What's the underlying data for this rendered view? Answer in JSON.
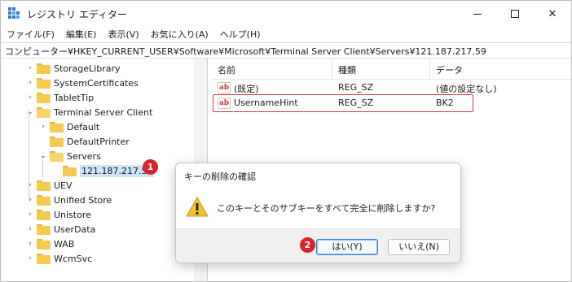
{
  "window": {
    "title": "レジストリ エディター"
  },
  "menu": [
    "ファイル(F)",
    "編集(E)",
    "表示(V)",
    "お気に入り(A)",
    "ヘルプ(H)"
  ],
  "address": "コンピューター¥HKEY_CURRENT_USER¥Software¥Microsoft¥Terminal Server Client¥Servers¥121.187.217.59",
  "tree": {
    "items": [
      {
        "label": "StorageLibrary",
        "expand": "collapsed"
      },
      {
        "label": "SystemCertificates",
        "expand": "collapsed"
      },
      {
        "label": "TabletTip",
        "expand": "collapsed"
      },
      {
        "label": "Terminal Server Client",
        "expand": "expanded"
      },
      {
        "label": "Default",
        "expand": "collapsed"
      },
      {
        "label": "DefaultPrinter",
        "expand": "none"
      },
      {
        "label": "Servers",
        "expand": "expanded"
      },
      {
        "label": "121.187.217.59",
        "expand": "none",
        "selected": true
      },
      {
        "label": "UEV",
        "expand": "collapsed"
      },
      {
        "label": "Unified Store",
        "expand": "collapsed"
      },
      {
        "label": "Unistore",
        "expand": "collapsed"
      },
      {
        "label": "UserData",
        "expand": "collapsed"
      },
      {
        "label": "WAB",
        "expand": "collapsed"
      },
      {
        "label": "WcmSvc",
        "expand": "collapsed"
      }
    ]
  },
  "list": {
    "columns": [
      "名前",
      "種類",
      "データ"
    ],
    "rows": [
      {
        "name": "(既定)",
        "type": "REG_SZ",
        "data": "(値の設定なし)"
      },
      {
        "name": "UsernameHint",
        "type": "REG_SZ",
        "data": "BK2"
      }
    ]
  },
  "dialog": {
    "title": "キーの削除の確認",
    "message": "このキーとそのサブキーをすべて完全に削除しますか?",
    "yes_label": "はい(Y)",
    "no_label": "いいえ(N)"
  },
  "badges": {
    "step1": "1",
    "step2": "2"
  },
  "colors": {
    "badge": "#d9222a",
    "highlight_border": "#d9363e",
    "selection": "#cce4f7",
    "folder": "#f6c94f"
  },
  "icons": {
    "app": "registry-editor-icon",
    "folder": "folder-icon",
    "value": "string-value-icon",
    "warning": "warning-icon"
  }
}
